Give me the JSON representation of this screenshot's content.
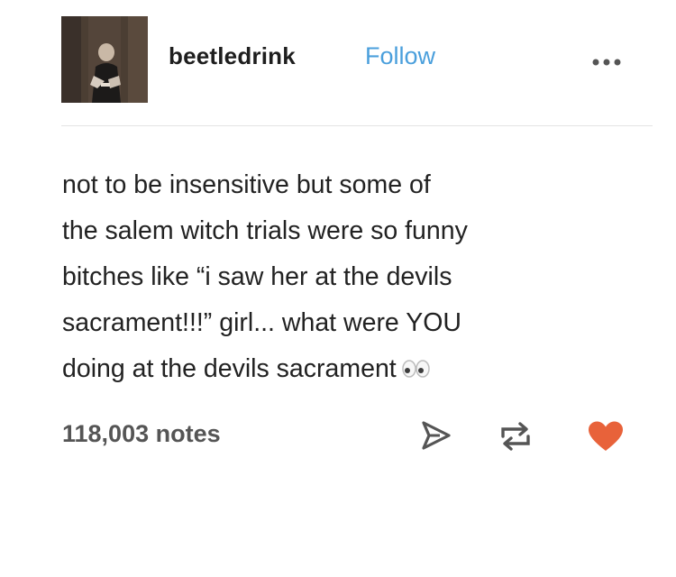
{
  "post": {
    "author": "beetledrink",
    "follow_label": "Follow",
    "body_lines": [
      "not to be insensitive but some of",
      "the salem witch trials were so funny",
      "bitches like “i saw her at the devils",
      "sacrament!!!” girl... what were YOU",
      "doing at the devils sacrament"
    ],
    "emoji_icon": "eyes-icon",
    "notes": "118,003 notes"
  },
  "icons": {
    "more": "more-options-icon",
    "share": "share-icon",
    "reblog": "reblog-icon",
    "like": "heart-icon"
  },
  "colors": {
    "follow": "#4a9fdc",
    "like": "#e8623a",
    "icon": "#555555",
    "text": "#222222"
  }
}
